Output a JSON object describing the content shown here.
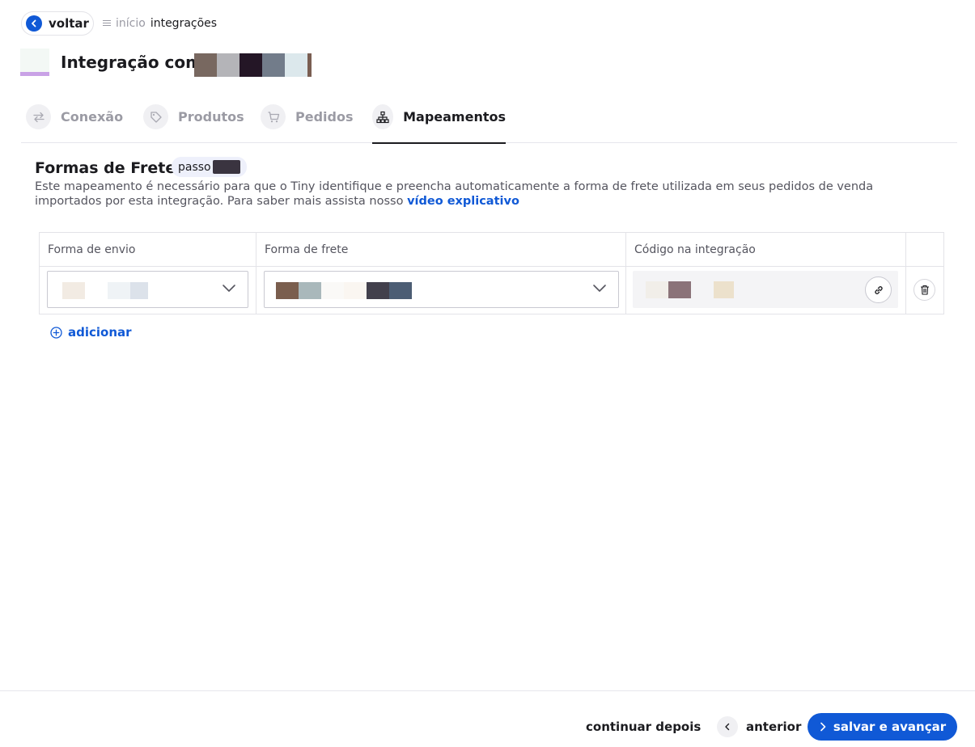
{
  "topbar": {
    "back_label": "voltar",
    "breadcrumb": {
      "home": "início",
      "current": "integrações"
    }
  },
  "header": {
    "title": "Integração com",
    "redacted_colors": [
      "#786860",
      "#b4b4b8",
      "#241626",
      "#727c8a",
      "#dce8ec",
      "#7a5e52"
    ]
  },
  "tabs": [
    {
      "label": "Conexão",
      "icon": "arrows-exchange-icon",
      "active": false
    },
    {
      "label": "Produtos",
      "icon": "tag-icon",
      "active": false
    },
    {
      "label": "Pedidos",
      "icon": "cart-icon",
      "active": false
    },
    {
      "label": "Mapeamentos",
      "icon": "hierarchy-icon",
      "active": true
    }
  ],
  "section": {
    "title": "Formas de Frete",
    "step_badge": "passo",
    "description": "Este mapeamento é necessário para que o Tiny identifique e preencha automaticamente a forma de frete utilizada em seus pedidos de venda importados por esta integração. Para saber mais assista nosso ",
    "description_link": "vídeo explicativo"
  },
  "table": {
    "headers": [
      "Forma de envio",
      "Forma de frete",
      "Código na integração"
    ],
    "row": {
      "envio_colors": [
        "#f2ebe3",
        "#ffffff",
        "#eff3f6",
        "#dce2ea"
      ],
      "frete_colors": [
        "#7a5e4e",
        "#a9b8bb",
        "#faf9f7",
        "#faf6f1",
        "#42404c",
        "#4c5d74"
      ],
      "codigo_colors": [
        "#f1eee9",
        "#f4f4f6",
        "#8b7379",
        "#f4f4f6",
        "#ece1cc"
      ]
    }
  },
  "add_label": "adicionar",
  "footer": {
    "later": "continuar depois",
    "previous": "anterior",
    "next": "salvar e avançar"
  },
  "colors": {
    "accent": "#1059d6",
    "text": "#1b1b1f",
    "muted": "#9b9ba4"
  }
}
